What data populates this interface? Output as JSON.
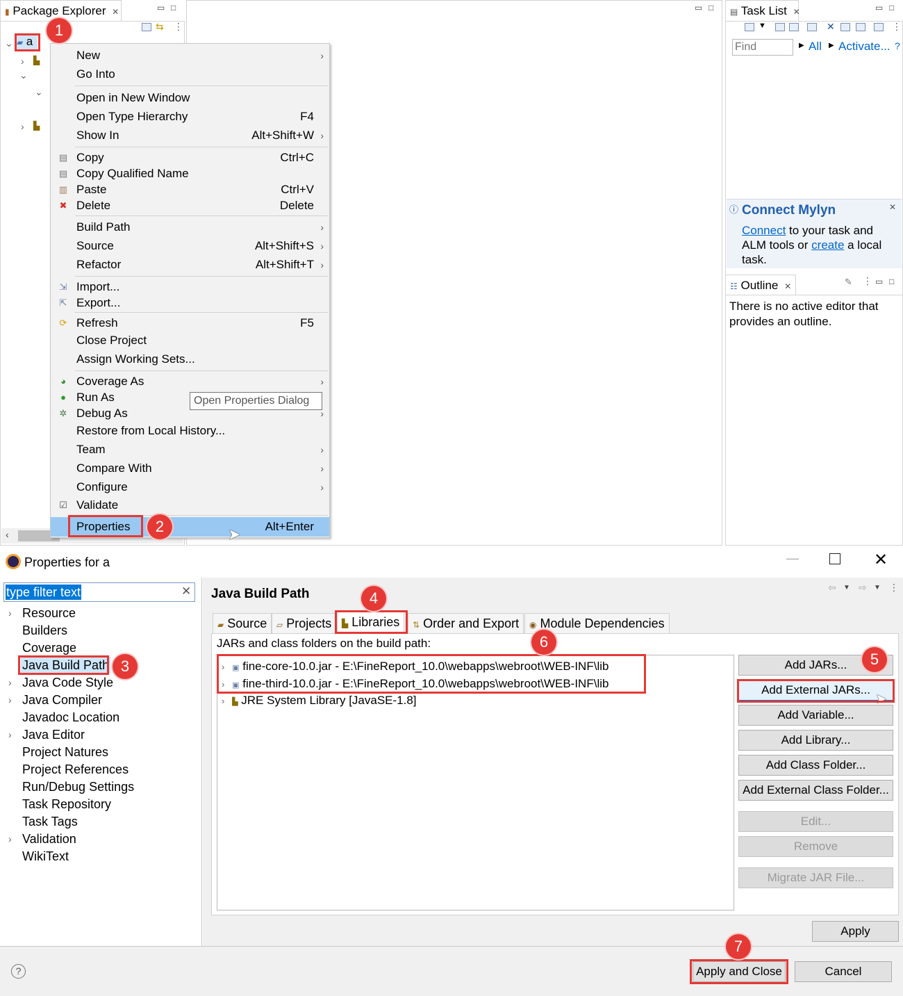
{
  "package_explorer": {
    "title": "Package Explorer",
    "project_label": "a"
  },
  "context_menu": {
    "items": [
      {
        "label": "New",
        "shortcut": ""
      },
      {
        "label": "Go Into",
        "shortcut": ""
      },
      {
        "label": "Open in New Window",
        "shortcut": ""
      },
      {
        "label": "Open Type Hierarchy",
        "shortcut": "F4"
      },
      {
        "label": "Show In",
        "shortcut": "Alt+Shift+W"
      },
      {
        "label": "Copy",
        "shortcut": "Ctrl+C"
      },
      {
        "label": "Copy Qualified Name",
        "shortcut": ""
      },
      {
        "label": "Paste",
        "shortcut": "Ctrl+V"
      },
      {
        "label": "Delete",
        "shortcut": "Delete"
      },
      {
        "label": "Build Path",
        "shortcut": ""
      },
      {
        "label": "Source",
        "shortcut": "Alt+Shift+S"
      },
      {
        "label": "Refactor",
        "shortcut": "Alt+Shift+T"
      },
      {
        "label": "Import...",
        "shortcut": ""
      },
      {
        "label": "Export...",
        "shortcut": ""
      },
      {
        "label": "Refresh",
        "shortcut": "F5"
      },
      {
        "label": "Close Project",
        "shortcut": ""
      },
      {
        "label": "Assign Working Sets...",
        "shortcut": ""
      },
      {
        "label": "Coverage As",
        "shortcut": ""
      },
      {
        "label": "Run As",
        "shortcut": ""
      },
      {
        "label": "Debug As",
        "shortcut": ""
      },
      {
        "label": "Restore from Local History...",
        "shortcut": ""
      },
      {
        "label": "Team",
        "shortcut": ""
      },
      {
        "label": "Compare With",
        "shortcut": ""
      },
      {
        "label": "Configure",
        "shortcut": ""
      },
      {
        "label": "Validate",
        "shortcut": ""
      },
      {
        "label": "Properties",
        "shortcut": "Alt+Enter"
      }
    ],
    "tooltip": "Open Properties Dialog"
  },
  "task_list": {
    "title": "Task List",
    "find_placeholder": "Find",
    "all_link": "All",
    "activate_link": "Activate..."
  },
  "mylyn": {
    "title": "Connect Mylyn",
    "connect_link": "Connect",
    "text1": " to your task and ALM tools or ",
    "create_link": "create",
    "text2": " a local task."
  },
  "outline": {
    "title": "Outline",
    "message": "There is no active editor that provides an outline."
  },
  "dialog": {
    "title": "Properties for a",
    "filter_value": "type filter text",
    "tree": [
      "Resource",
      "Builders",
      "Coverage",
      "Java Build Path",
      "Java Code Style",
      "Java Compiler",
      "Javadoc Location",
      "Java Editor",
      "Project Natures",
      "Project References",
      "Run/Debug Settings",
      "Task Repository",
      "Task Tags",
      "Validation",
      "WikiText"
    ],
    "page_title": "Java Build Path",
    "tabs": [
      "Source",
      "Projects",
      "Libraries",
      "Order and Export",
      "Module Dependencies"
    ],
    "list_caption": "JARs and class folders on the build path:",
    "entries": [
      "fine-core-10.0.jar - E:\\FineReport_10.0\\webapps\\webroot\\WEB-INF\\lib",
      "fine-third-10.0.jar - E:\\FineReport_10.0\\webapps\\webroot\\WEB-INF\\lib",
      "JRE System Library [JavaSE-1.8]"
    ],
    "buttons": [
      "Add JARs...",
      "Add External JARs...",
      "Add Variable...",
      "Add Library...",
      "Add Class Folder...",
      "Add External Class Folder...",
      "Edit...",
      "Remove",
      "Migrate JAR File..."
    ],
    "apply": "Apply",
    "apply_close": "Apply and Close",
    "cancel": "Cancel",
    "help": "?"
  },
  "badges": [
    "1",
    "2",
    "3",
    "4",
    "5",
    "6",
    "7"
  ],
  "colors": {
    "annotation_red": "#e53935",
    "selection_blue": "#99c9f3",
    "link_blue": "#0066cc"
  }
}
